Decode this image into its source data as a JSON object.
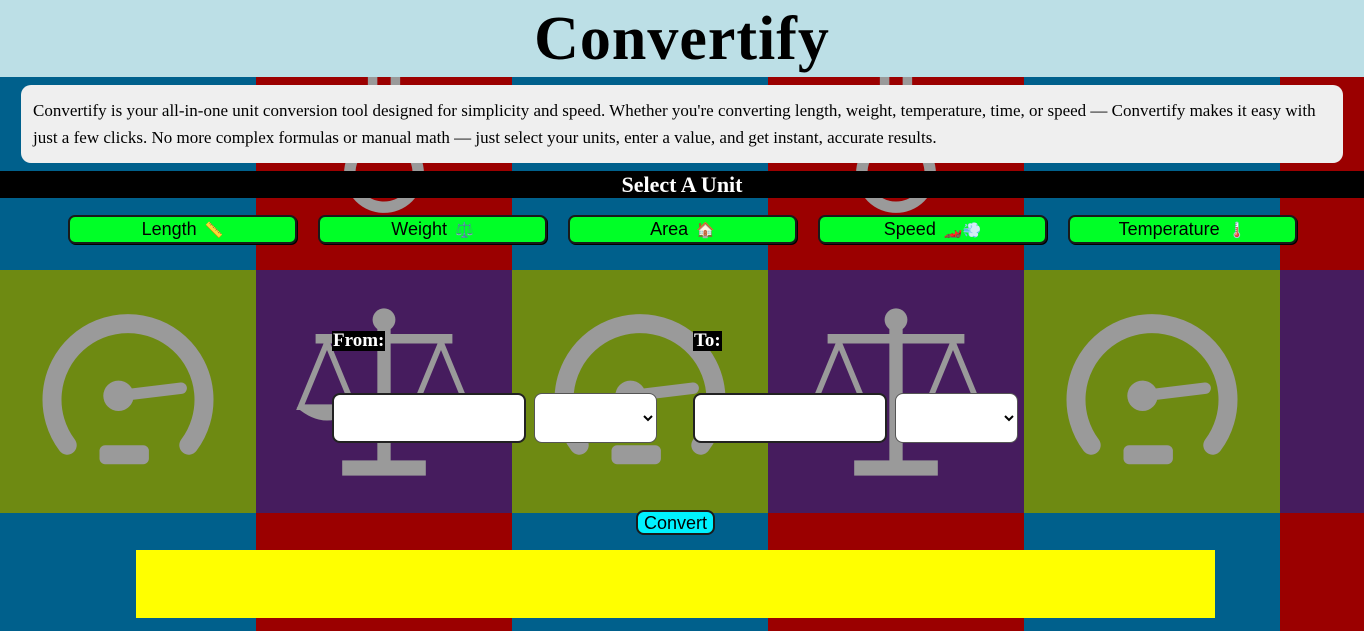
{
  "app": {
    "title": "Convertify",
    "description": "Convertify is your all-in-one unit conversion tool designed for simplicity and speed. Whether you're converting length, weight, temperature, time, or speed — Convertify makes it easy with just a few clicks. No more complex formulas or manual math — just select your units, enter a value, and get instant, accurate results."
  },
  "unit_section": {
    "heading": "Select A Unit",
    "buttons": [
      {
        "label": "Length",
        "icon": "📏",
        "icon_name": "ruler-icon"
      },
      {
        "label": "Weight",
        "icon": "⚖️",
        "icon_name": "scales-icon"
      },
      {
        "label": "Area",
        "icon": "🏠",
        "icon_name": "house-icon"
      },
      {
        "label": "Speed",
        "icon": "🏎️💨",
        "icon_name": "race-car-icon"
      },
      {
        "label": "Temperature",
        "icon": "🌡️",
        "icon_name": "thermometer-icon"
      }
    ]
  },
  "converter": {
    "from_label": "From:",
    "to_label": "To:",
    "from_value": "",
    "to_value": "",
    "from_unit": "",
    "to_unit": "",
    "convert_label": "Convert",
    "result": ""
  },
  "colors": {
    "header_bg": "#bcdfe6",
    "unit_button": "#00ff27",
    "convert_button": "#00f2ff",
    "result_bg": "#ffff00",
    "tile_blue": "#00608c",
    "tile_red": "#9b0000",
    "tile_olive": "#6e8a12",
    "tile_purple": "#461c5e"
  }
}
